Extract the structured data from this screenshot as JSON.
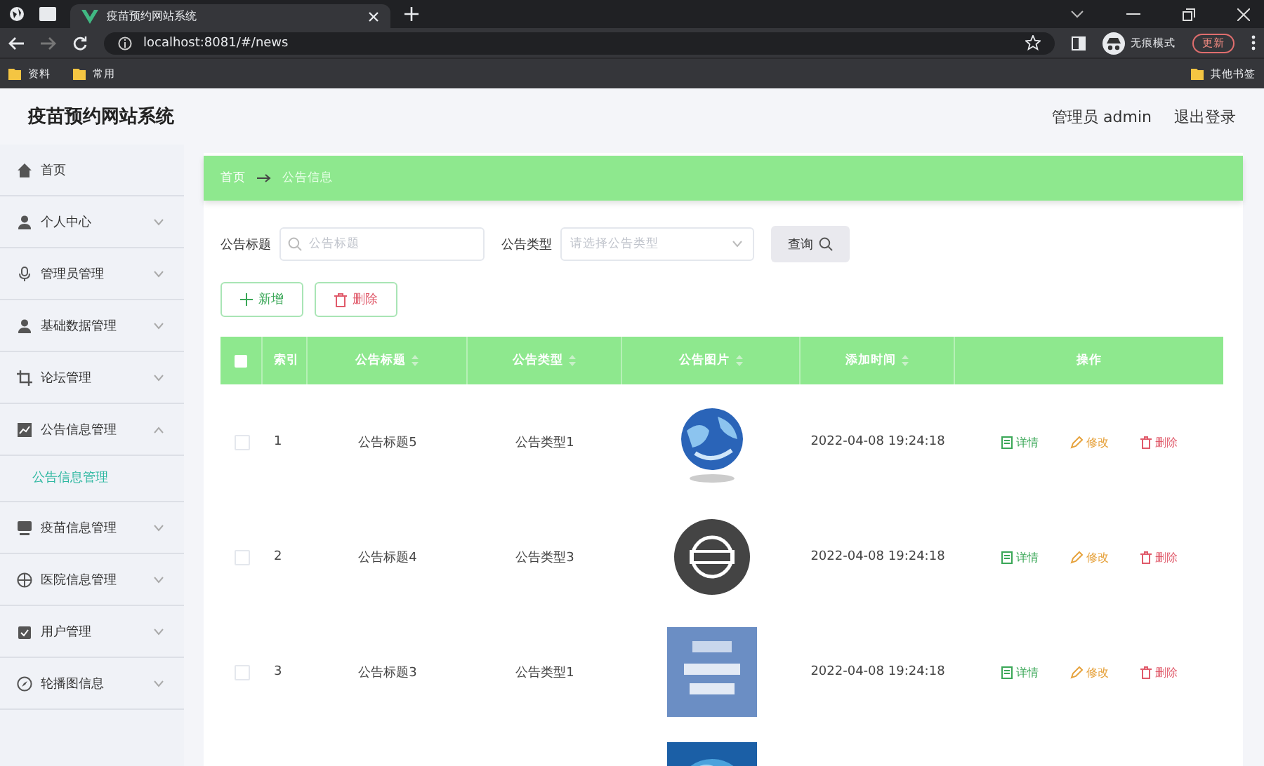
{
  "browser": {
    "tab_title": "疫苗预约网站系统",
    "url": "localhost:8081/#/news",
    "incognito_label": "无痕模式",
    "update_label": "更新",
    "bookmarks": [
      "资料",
      "常用"
    ],
    "other_bookmarks": "其他书签"
  },
  "header": {
    "title": "疫苗预约网站系统",
    "user_label": "管理员 admin",
    "logout": "退出登录"
  },
  "sidebar": {
    "items": [
      {
        "label": "首页",
        "selected": false
      },
      {
        "label": "个人中心",
        "selected": false,
        "expanded": false
      },
      {
        "label": "管理员管理",
        "selected": false,
        "expanded": false
      },
      {
        "label": "基础数据管理",
        "selected": false,
        "expanded": false
      },
      {
        "label": "论坛管理",
        "selected": false,
        "expanded": false
      },
      {
        "label": "公告信息管理",
        "selected": false,
        "expanded": true,
        "children": [
          {
            "label": "公告信息管理",
            "selected": true
          }
        ]
      },
      {
        "label": "疫苗信息管理",
        "selected": false,
        "expanded": false
      },
      {
        "label": "医院信息管理",
        "selected": false,
        "expanded": false
      },
      {
        "label": "用户管理",
        "selected": false,
        "expanded": false
      },
      {
        "label": "轮播图信息",
        "selected": false,
        "expanded": false
      }
    ]
  },
  "breadcrumb": [
    "首页",
    "公告信息"
  ],
  "search": {
    "fields": [
      {
        "kind": "text",
        "label": "公告标题",
        "placeholder": "公告标题"
      },
      {
        "kind": "select",
        "label": "公告类型",
        "placeholder": "请选择公告类型"
      }
    ],
    "button": "查询"
  },
  "toolbar": [
    {
      "kind": "add",
      "label": "新增"
    },
    {
      "kind": "delete",
      "label": "删除"
    }
  ],
  "table": {
    "select_all": {
      "checked": false
    },
    "columns": [
      {
        "label": "索引",
        "sortable": false
      },
      {
        "label": "公告标题",
        "sortable": true
      },
      {
        "label": "公告类型",
        "sortable": true
      },
      {
        "label": "公告图片",
        "sortable": true
      },
      {
        "label": "添加时间",
        "sortable": true
      },
      {
        "label": "操作",
        "sortable": false
      }
    ],
    "rows": [
      {
        "selected": false,
        "index": "1",
        "title": "公告标题5",
        "type": "公告类型1",
        "image": {
          "kind": "picture"
        },
        "time": "2022-04-08 19:24:18",
        "actions": [
          {
            "kind": "detail",
            "label": "详情"
          },
          {
            "kind": "edit",
            "label": "修改"
          },
          {
            "kind": "delete",
            "label": "删除"
          }
        ]
      },
      {
        "selected": false,
        "index": "2",
        "title": "公告标题4",
        "type": "公告类型3",
        "image": {
          "kind": "picture"
        },
        "time": "2022-04-08 19:24:18",
        "actions": [
          {
            "kind": "detail",
            "label": "详情"
          },
          {
            "kind": "edit",
            "label": "修改"
          },
          {
            "kind": "delete",
            "label": "删除"
          }
        ]
      },
      {
        "selected": false,
        "index": "3",
        "title": "公告标题3",
        "type": "公告类型1",
        "image": {
          "kind": "picture"
        },
        "time": "2022-04-08 19:24:18",
        "actions": [
          {
            "kind": "detail",
            "label": "详情"
          },
          {
            "kind": "edit",
            "label": "修改"
          },
          {
            "kind": "delete",
            "label": "删除"
          }
        ]
      },
      {
        "image": {
          "kind": "picture"
        }
      }
    ]
  }
}
